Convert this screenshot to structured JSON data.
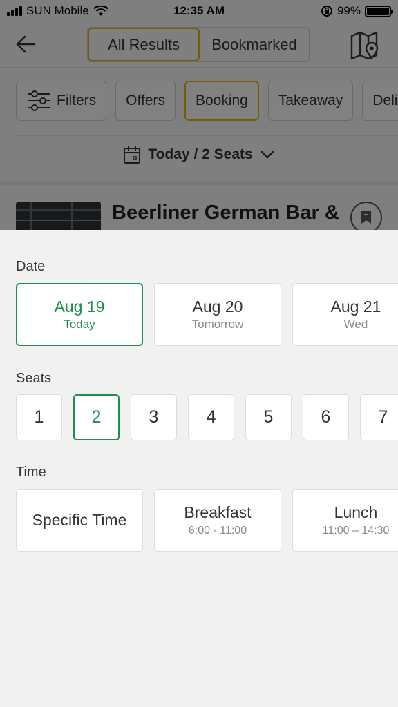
{
  "status_bar": {
    "carrier": "SUN Mobile",
    "time": "12:35 AM",
    "battery": "99%"
  },
  "nav": {
    "tab_all": "All Results",
    "tab_bookmarked": "Bookmarked",
    "active_tab": "All Results"
  },
  "chips": [
    {
      "label": "Filters",
      "selected": false
    },
    {
      "label": "Offers",
      "selected": false
    },
    {
      "label": "Booking",
      "selected": true
    },
    {
      "label": "Takeaway",
      "selected": false
    },
    {
      "label": "Deli",
      "selected": false
    }
  ],
  "date_seat_selector": "Today / 2 Seats",
  "restaurant": {
    "name": "Beerliner German Bar &"
  },
  "sheet": {
    "date_label": "Date",
    "dates": [
      {
        "main": "Aug 19",
        "sub": "Today",
        "selected": true
      },
      {
        "main": "Aug 20",
        "sub": "Tomorrow",
        "selected": false
      },
      {
        "main": "Aug 21",
        "sub": "Wed",
        "selected": false
      }
    ],
    "seats_label": "Seats",
    "seats": [
      "1",
      "2",
      "3",
      "4",
      "5",
      "6",
      "7"
    ],
    "selected_seat": "2",
    "time_label": "Time",
    "times": [
      {
        "main": "Specific Time",
        "sub": ""
      },
      {
        "main": "Breakfast",
        "sub": "6:00 - 11:00"
      },
      {
        "main": "Lunch",
        "sub": "11:00 – 14:30"
      }
    ]
  },
  "colors": {
    "accent_green": "#1f8f4e",
    "accent_yellow": "#e0b400"
  }
}
